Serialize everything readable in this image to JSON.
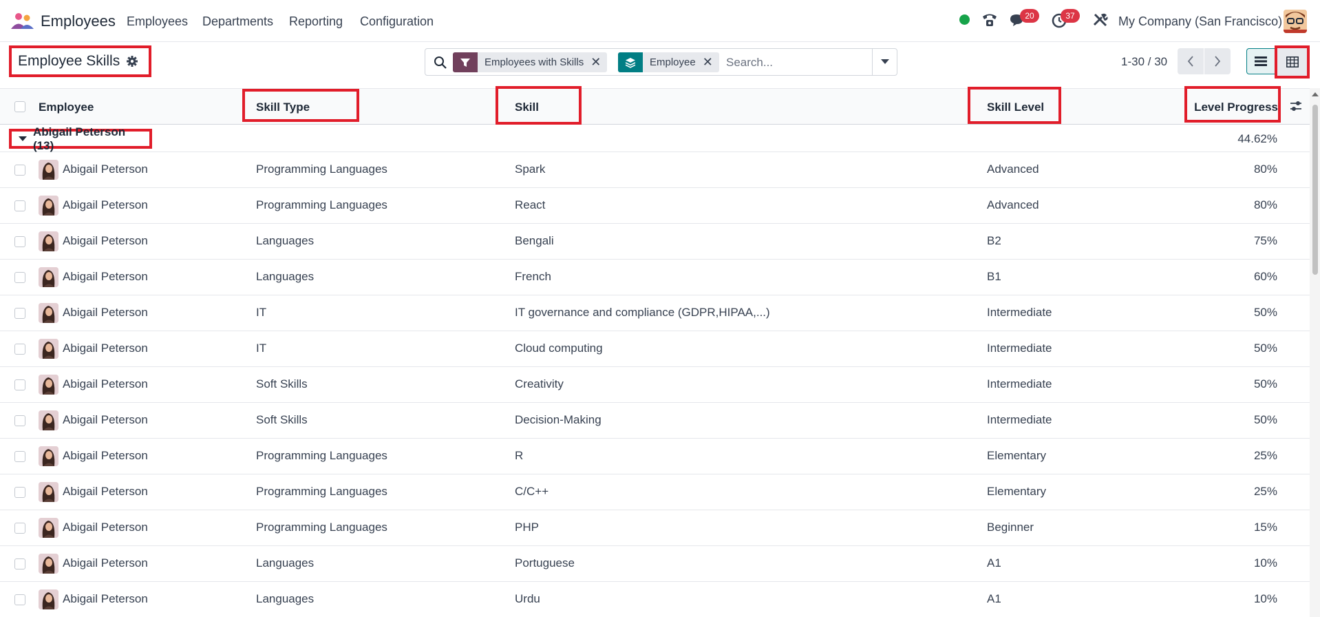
{
  "navbar": {
    "app_name": "Employees",
    "menu": [
      "Employees",
      "Departments",
      "Reporting",
      "Configuration"
    ],
    "messages_badge": "20",
    "activities_badge": "37",
    "company": "My Company (San Francisco)",
    "status_color": "#16a34a"
  },
  "control_panel": {
    "title": "Employee Skills",
    "filters": [
      {
        "label": "Employees with Skills",
        "icon": "filter-icon",
        "color": "#71405c"
      },
      {
        "label": "Employee",
        "icon": "group-by-layers-icon",
        "color": "#017e84"
      }
    ],
    "search_placeholder": "Search...",
    "pager": "1-30 / 30"
  },
  "table": {
    "columns": [
      "Employee",
      "Skill Type",
      "Skill",
      "Skill Level",
      "Level Progress"
    ],
    "group": {
      "label": "Abigail Peterson (13)",
      "aggregate": "44.62%"
    },
    "rows": [
      {
        "employee": "Abigail Peterson",
        "skill_type": "Programming Languages",
        "skill": "Spark",
        "level": "Advanced",
        "progress": "80%"
      },
      {
        "employee": "Abigail Peterson",
        "skill_type": "Programming Languages",
        "skill": "React",
        "level": "Advanced",
        "progress": "80%"
      },
      {
        "employee": "Abigail Peterson",
        "skill_type": "Languages",
        "skill": "Bengali",
        "level": "B2",
        "progress": "75%"
      },
      {
        "employee": "Abigail Peterson",
        "skill_type": "Languages",
        "skill": "French",
        "level": "B1",
        "progress": "60%"
      },
      {
        "employee": "Abigail Peterson",
        "skill_type": "IT",
        "skill": "IT governance and compliance (GDPR,HIPAA,...)",
        "level": "Intermediate",
        "progress": "50%"
      },
      {
        "employee": "Abigail Peterson",
        "skill_type": "IT",
        "skill": "Cloud computing",
        "level": "Intermediate",
        "progress": "50%"
      },
      {
        "employee": "Abigail Peterson",
        "skill_type": "Soft Skills",
        "skill": "Creativity",
        "level": "Intermediate",
        "progress": "50%"
      },
      {
        "employee": "Abigail Peterson",
        "skill_type": "Soft Skills",
        "skill": "Decision-Making",
        "level": "Intermediate",
        "progress": "50%"
      },
      {
        "employee": "Abigail Peterson",
        "skill_type": "Programming Languages",
        "skill": "R",
        "level": "Elementary",
        "progress": "25%"
      },
      {
        "employee": "Abigail Peterson",
        "skill_type": "Programming Languages",
        "skill": "C/C++",
        "level": "Elementary",
        "progress": "25%"
      },
      {
        "employee": "Abigail Peterson",
        "skill_type": "Programming Languages",
        "skill": "PHP",
        "level": "Beginner",
        "progress": "15%"
      },
      {
        "employee": "Abigail Peterson",
        "skill_type": "Languages",
        "skill": "Portuguese",
        "level": "A1",
        "progress": "10%"
      },
      {
        "employee": "Abigail Peterson",
        "skill_type": "Languages",
        "skill": "Urdu",
        "level": "A1",
        "progress": "10%"
      }
    ]
  }
}
